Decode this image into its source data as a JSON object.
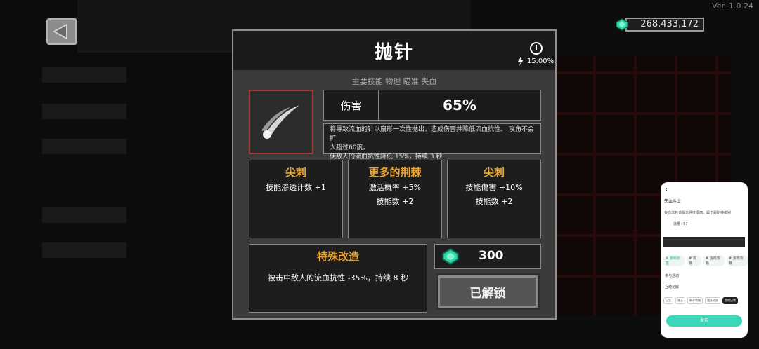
{
  "version": "Ver. 1.0.24",
  "currency": {
    "amount": "268,433,172"
  },
  "skill": {
    "title": "抛针",
    "cooldown": "15.00%",
    "info_glyph": "i",
    "tags": "主要技能  物理  瞄准  失血",
    "damage_label": "伤害",
    "damage_value": "65%",
    "desc_line1": "将导致流血的针以扇形一次性抛出，造成伤害并降低流血抗性。 攻角不会扩",
    "desc_line2": "大超过60度。",
    "desc_line3": "使敌人的流血抗性降低 15%，持续 3 秒"
  },
  "mods": [
    {
      "title": "尖刺",
      "line1": "技能渗透计数 +1",
      "line2": ""
    },
    {
      "title": "更多的荆棘",
      "line1": "激活概率 +5%",
      "line2": "技能数 +2"
    },
    {
      "title": "尖刺",
      "line1": "技能傷害 +10%",
      "line2": "技能数 +2"
    }
  ],
  "special": {
    "title": "特殊改造",
    "line": "被击中敌人的流血抗性 -35%，持续 8 秒"
  },
  "cost": {
    "value": "300"
  },
  "unlock_label": "已解锁",
  "phone": {
    "back": "‹",
    "title": "失血斗士",
    "line1": "失血流在该版本强度很高，属于是职棒级别",
    "line2": "流量+57",
    "chips": [
      "# 游戏标签",
      "# 攻略",
      "# 游戏攻略",
      "# 游戏攻略"
    ],
    "row1": "参与活动",
    "row2": "互动见解",
    "tabs": [
      "日志",
      "骑士",
      "新手攻略",
      "更多武器",
      "游戏日常"
    ],
    "publish": "发布"
  },
  "colors": {
    "accent": "#e8a536",
    "gem": "#2fd6a6",
    "border_red": "#a43a3a"
  }
}
